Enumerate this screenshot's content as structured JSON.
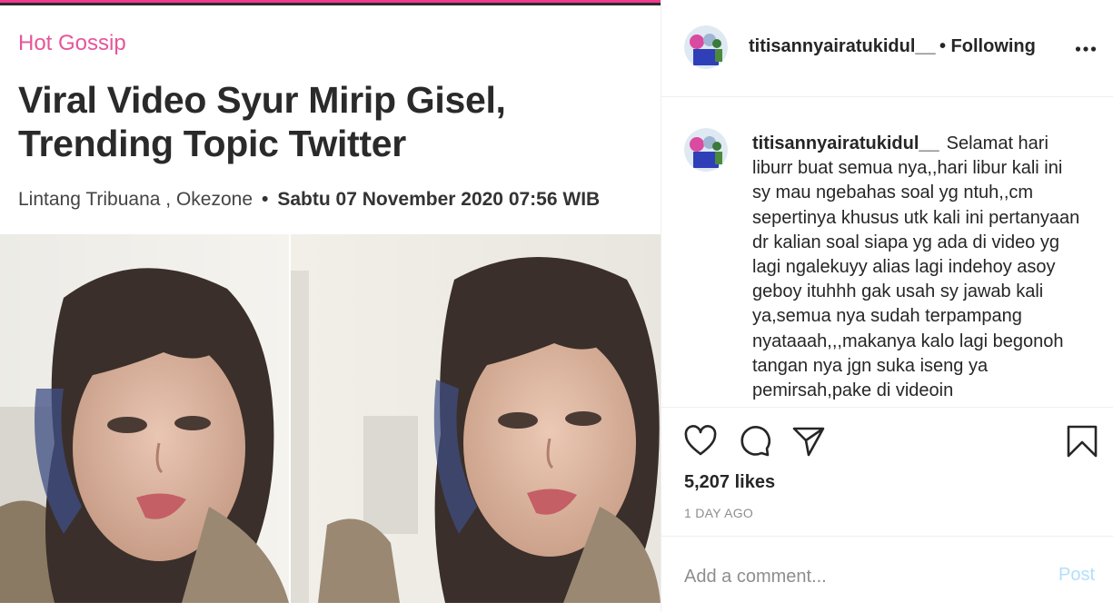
{
  "article": {
    "category": "Hot Gossip",
    "headline": "Viral Video Syur Mirip Gisel, Trending Topic Twitter",
    "author": "Lintang Tribuana , Okezone",
    "date": "Sabtu 07 November 2020 07:56 WIB"
  },
  "post": {
    "username": "titisannyairatukidul__",
    "follow_status": "• Following",
    "caption": "Selamat hari liburr buat semua nya,,hari libur kali ini sy mau ngebahas soal yg ntuh,,cm sepertinya khusus utk kali ini pertanyaan dr kalian soal siapa yg ada di video yg lagi ngalekuyy alias lagi indehoy asoy geboy ituhhh gak usah sy jawab kali ya,semua nya sudah terpampang nyataaah,,,makanya kalo lagi begonoh tangan nya jgn suka iseng ya pemirsah,pake di videoin",
    "likes": "5,207 likes",
    "time_ago": "1 DAY AGO"
  },
  "comment": {
    "placeholder": "Add a comment...",
    "post_label": "Post"
  },
  "icons": {
    "like": "heart-icon",
    "comment": "comment-bubble-icon",
    "share": "paper-plane-icon",
    "save": "bookmark-icon",
    "more": "ellipsis-icon"
  },
  "colors": {
    "category": "#e6559a",
    "post_button_disabled": "#b2dffc",
    "muted": "#8e8e8e"
  }
}
